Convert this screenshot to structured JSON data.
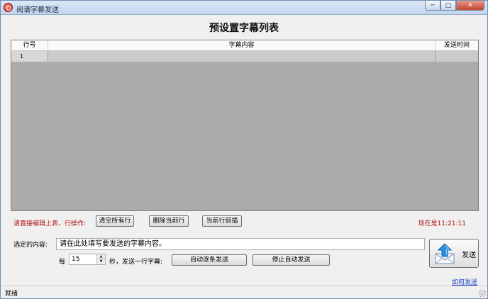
{
  "window": {
    "title": "阅谱字幕发送",
    "controls": [
      "─",
      "□",
      "✕"
    ]
  },
  "heading": "预设置字幕列表",
  "grid": {
    "columns": [
      "行号",
      "字幕内容",
      "发送时间"
    ],
    "rows": [
      {
        "num": "1",
        "content": "",
        "time": ""
      }
    ]
  },
  "toolbar": {
    "hint": "请直接编辑上表，行操作:",
    "clear_all": "清空所有行",
    "delete_current": "删除当前行",
    "insert_before": "当前行前插"
  },
  "clock": "现在是11:21:11",
  "selected": {
    "label": "选定的内容:",
    "value": "请在此处填写要发送的字幕内容。"
  },
  "auto": {
    "every": "每",
    "interval": "15",
    "suffix": "秒，发送一行字幕:",
    "start": "自动逐条发送",
    "stop": "停止自动发送"
  },
  "send": {
    "label": "发送",
    "icon": "envelope-upload-icon"
  },
  "help_link": "如何发送",
  "status": "就绪",
  "colors": {
    "accent_red": "#b01010",
    "grid_bg": "#ababab",
    "link_blue": "#1b3fcc"
  }
}
